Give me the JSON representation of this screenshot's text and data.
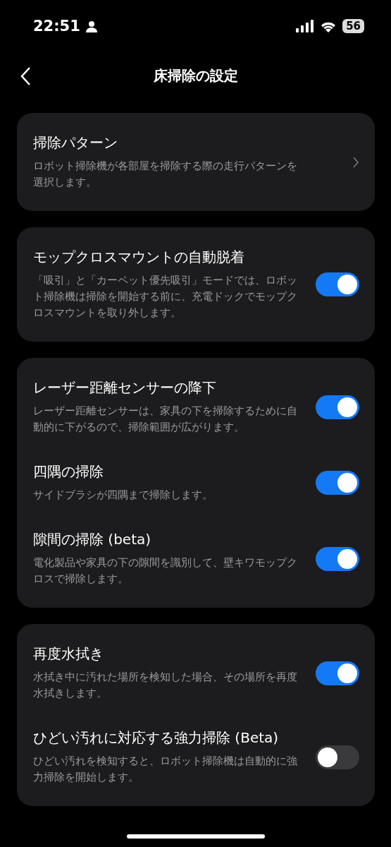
{
  "status_bar": {
    "time": "22:51",
    "battery": "56"
  },
  "header": {
    "title": "床掃除の設定"
  },
  "cards": [
    {
      "items": [
        {
          "kind": "link",
          "title": "掃除パターン",
          "description": "ロボット掃除機が各部屋を掃除する際の走行パターンを選択します。"
        }
      ]
    },
    {
      "items": [
        {
          "kind": "toggle",
          "title": "モップクロスマウントの自動脱着",
          "description": "「吸引」と「カーペット優先吸引」モードでは、ロボット掃除機は掃除を開始する前に、充電ドックでモップクロスマウントを取り外します。",
          "on": true
        }
      ]
    },
    {
      "items": [
        {
          "kind": "toggle",
          "title": "レーザー距離センサーの降下",
          "description": "レーザー距離センサーは、家具の下を掃除するために自動的に下がるので、掃除範囲が広がります。",
          "on": true
        },
        {
          "kind": "toggle",
          "title": "四隅の掃除",
          "description": "サイドブラシが四隅まで掃除します。",
          "on": true
        },
        {
          "kind": "toggle",
          "title": "隙間の掃除 (beta)",
          "description": "電化製品や家具の下の隙間を識別して、壁キワモップクロスで掃除します。",
          "on": true
        }
      ]
    },
    {
      "items": [
        {
          "kind": "toggle",
          "title": "再度水拭き",
          "description": "水拭き中に汚れた場所を検知した場合、その場所を再度水拭きします。",
          "on": true
        },
        {
          "kind": "toggle",
          "title": "ひどい汚れに対応する強力掃除 (Beta)",
          "description": "ひどい汚れを検知すると、ロボット掃除機は自動的に強力掃除を開始します。",
          "on": false
        }
      ]
    }
  ]
}
